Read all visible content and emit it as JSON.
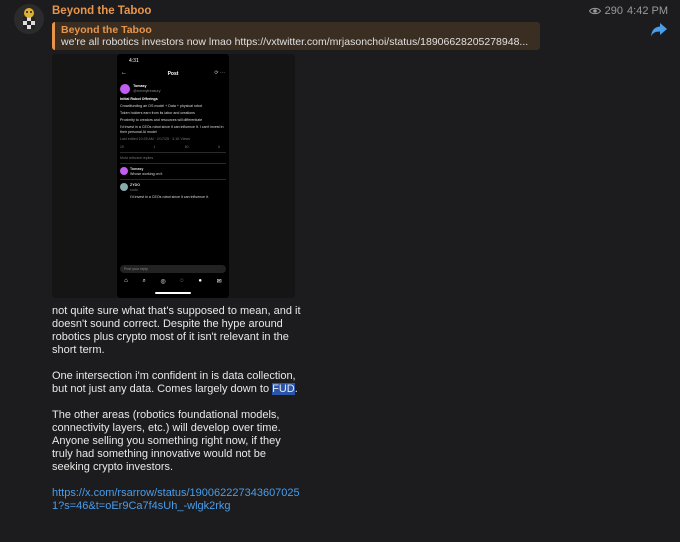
{
  "channel": {
    "name": "Beyond the Taboo"
  },
  "meta": {
    "views": "290",
    "time": "4:42 PM"
  },
  "reply": {
    "title": "Beyond the Taboo",
    "text": "we're all robotics investors now lmao   https://vxtwitter.com/mrjasonchoi/status/18906628205278948..."
  },
  "phone": {
    "status_time": "4:31",
    "title": "Post",
    "author_name": "Tomasy",
    "author_handle": "@tommytreasury",
    "heading": "Initial Robot Offerings",
    "lines": [
      "Crowdfunding an OS model + Data + physical robot",
      "Token holders earn from its labor and creations",
      "Proximity to creators and resources will differentiate",
      "I'd invest in a CEOs robot since it can influence it. I can't invest in their personal AI model"
    ],
    "sub": "Last edited 10:25 AM · 2/17/25 · 3.1K Views",
    "actions": [
      "19",
      "1",
      "60",
      "6"
    ],
    "relevant": "Most relevant replies",
    "reply1_author": "Tomasy",
    "reply1_text": "Whose working on it",
    "reply2_author": "ZYDO",
    "reply2_sub": "sudo",
    "reply2_text": "I'd invest in a CEOs robot since it can influence it.",
    "input_placeholder": "Post your reply"
  },
  "body": {
    "p1": "not quite sure what that's supposed to mean, and it doesn't sound correct. Despite the hype around robotics plus crypto most of it isn't relevant in the short term.",
    "p2_before": "One intersection i'm confident in is data collection, but not just any data. Comes largely down to ",
    "p2_highlight": "FUD",
    "p2_after": ".",
    "p3": "The other areas (robotics foundational models, connectivity layers, etc.) will develop over time. Anyone selling you something right now, if they truly had something innovative would not be seeking crypto investors.",
    "link": "https://x.com/rsarrow/status/1900622273436070251?s=46&t=oEr9Ca7f4sUh_-wlgk2rkg"
  },
  "colors": {
    "accent": "#e8954b",
    "link": "#4a9dea",
    "background": "#1c1c1e"
  },
  "icons": {
    "views": "eye-icon",
    "share": "share-arrow-icon"
  }
}
